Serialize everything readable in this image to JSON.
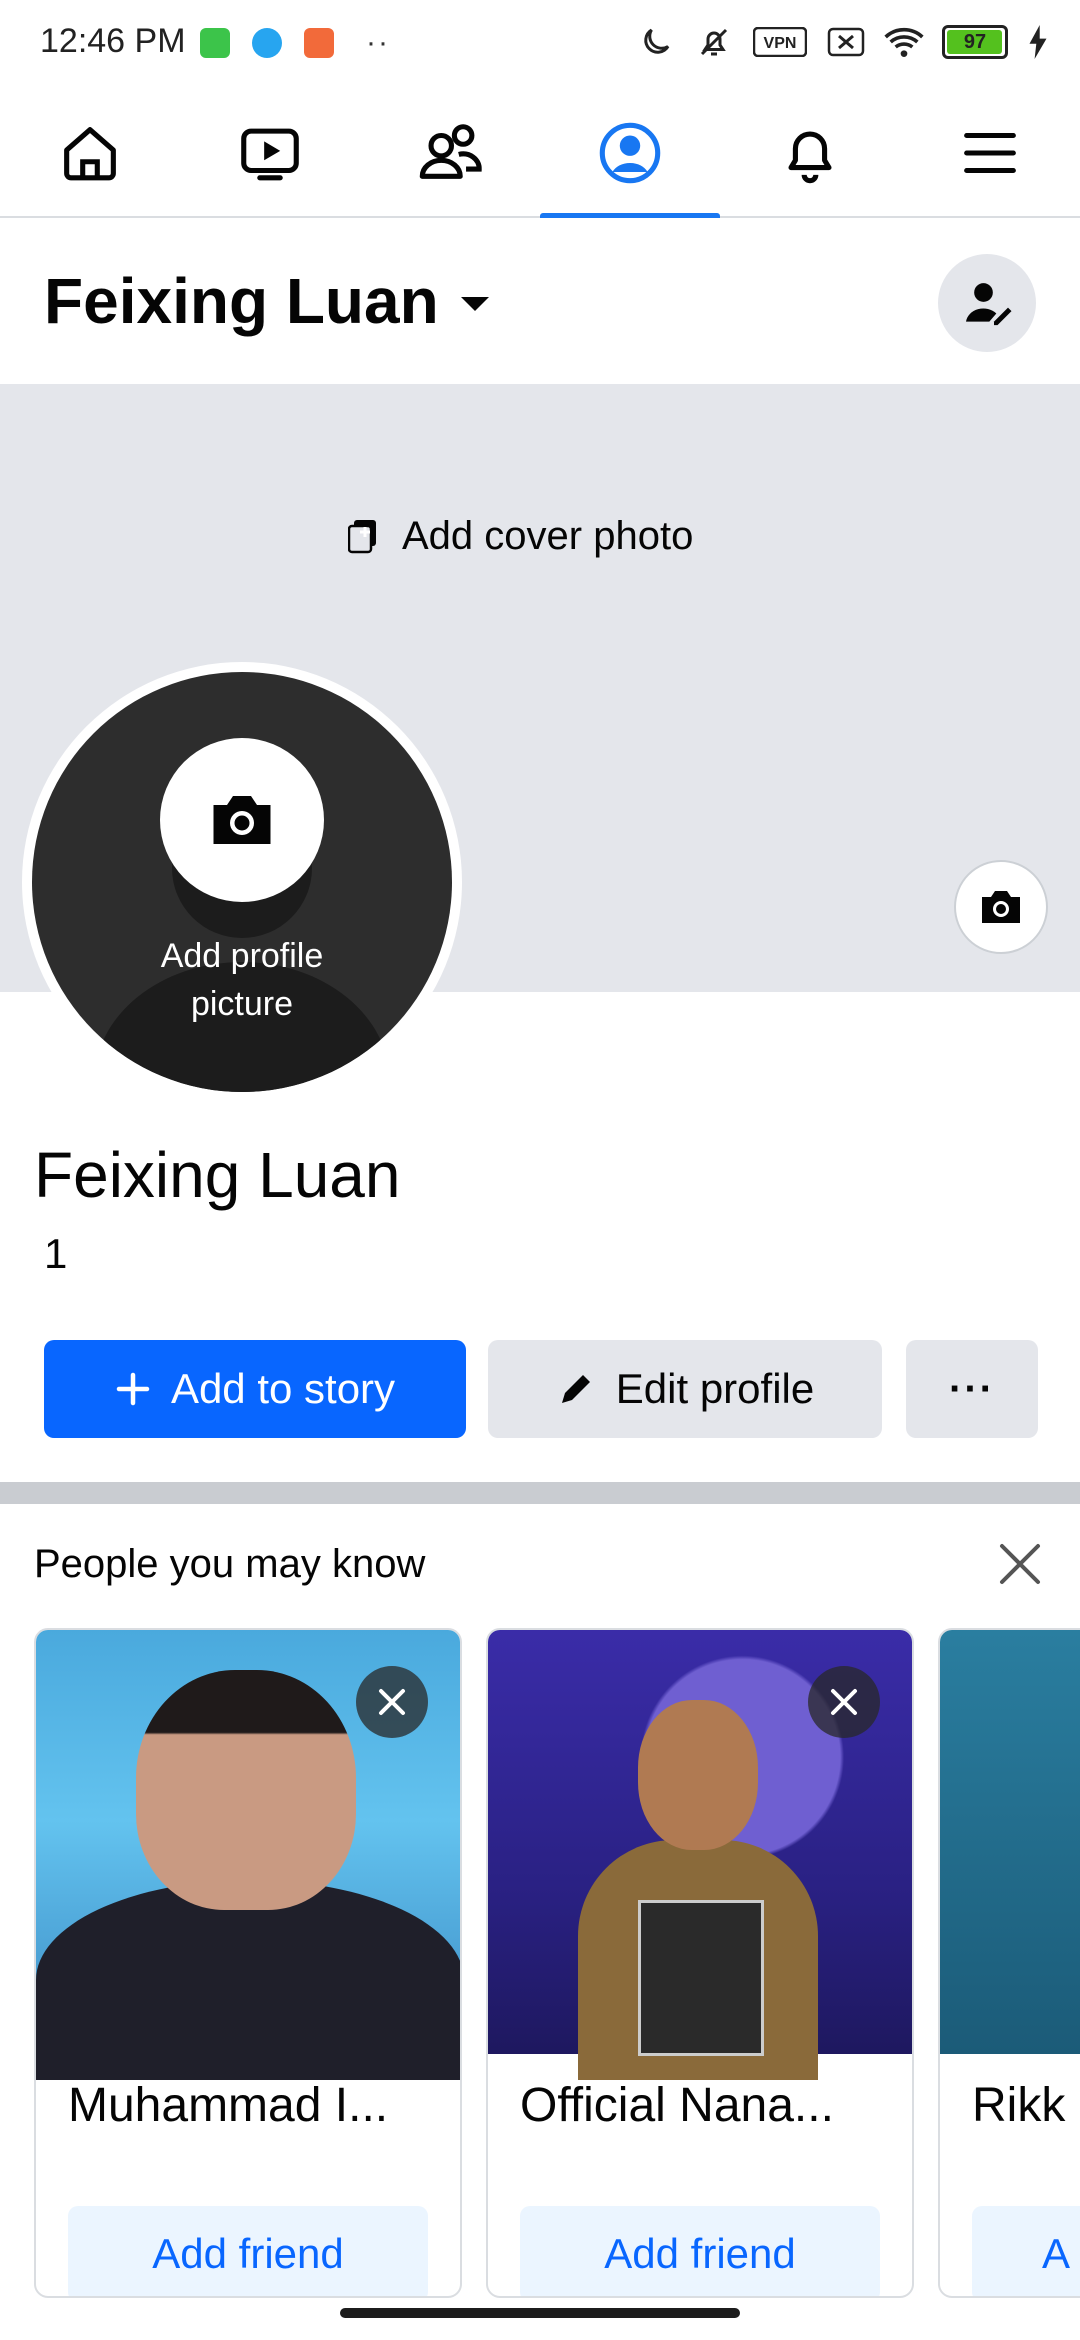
{
  "status_bar": {
    "time": "12:46 PM",
    "battery_level": "97",
    "icons": [
      "moon-icon",
      "bell-off-icon",
      "vpn-icon",
      "sim-off-icon",
      "wifi-icon",
      "battery-icon",
      "charging-icon"
    ]
  },
  "nav": {
    "items": [
      {
        "name": "home",
        "icon": "home-icon"
      },
      {
        "name": "video",
        "icon": "video-icon"
      },
      {
        "name": "friends",
        "icon": "friends-icon"
      },
      {
        "name": "profile",
        "icon": "profile-icon",
        "active": true
      },
      {
        "name": "notifications",
        "icon": "bell-icon"
      },
      {
        "name": "menu",
        "icon": "menu-icon"
      }
    ],
    "accent_color": "#1877f2"
  },
  "header": {
    "name": "Feixing Luan"
  },
  "cover": {
    "add_cover_label": "Add cover photo"
  },
  "avatar": {
    "add_profile_label_line1": "Add profile",
    "add_profile_label_line2": "picture"
  },
  "profile": {
    "name": "Feixing Luan",
    "count": "1"
  },
  "actions": {
    "add_story_label": "Add to story",
    "edit_profile_label": "Edit profile",
    "more_label": "···"
  },
  "pymk": {
    "title": "People you may know",
    "cards": [
      {
        "name": "Muhammad I...",
        "button": "Add friend"
      },
      {
        "name": "Official Nana...",
        "button": "Add friend"
      },
      {
        "name": "Rikk",
        "button": "A"
      }
    ]
  }
}
